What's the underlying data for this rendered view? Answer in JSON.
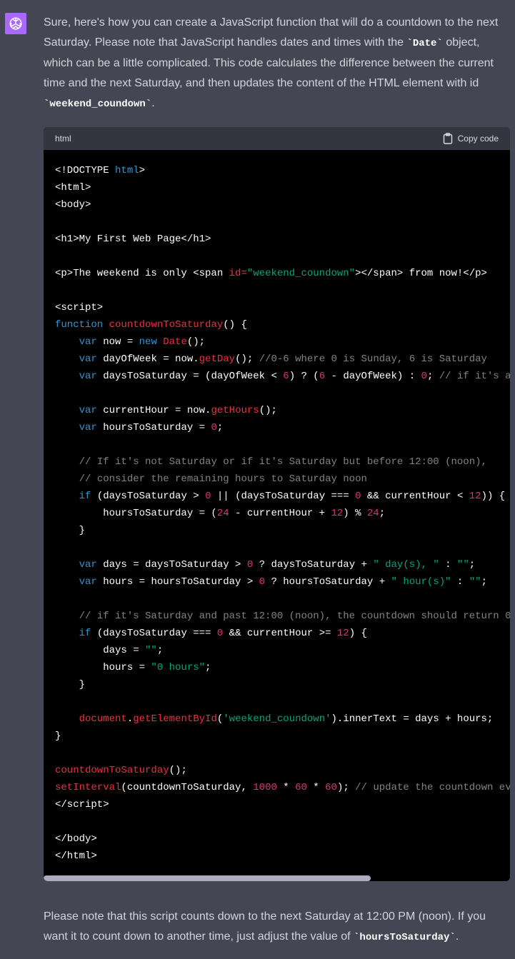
{
  "assistant": {
    "avatar_icon": "openai-logo-icon",
    "avatar_color": "#ab68ff"
  },
  "intro": {
    "before_date": "Sure, here's how you can create a JavaScript function that will do a countdown to the next Saturday. Please note that JavaScript handles dates and times with the ",
    "date_code": "`Date`",
    "middle": " object, which can be a little complicated. This code calculates the difference between the current time and the next Saturday, and then updates the content of the HTML element with id ",
    "id_code": "`weekend_coundown`",
    "end": "."
  },
  "code_block": {
    "language": "html",
    "copy_label": "Copy code",
    "copy_icon": "clipboard-icon",
    "scroll_position_fraction": 0,
    "lines": [
      [
        [
          "t",
          "<!DOCTYPE "
        ],
        [
          "k",
          "html"
        ],
        [
          "t",
          ">"
        ]
      ],
      [
        [
          "t",
          "<html>"
        ]
      ],
      [
        [
          "t",
          "<body>"
        ]
      ],
      [],
      [
        [
          "t",
          "<h1>My First Web Page</h1>"
        ]
      ],
      [],
      [
        [
          "t",
          "<p>The weekend is only <span "
        ],
        [
          "a",
          "id="
        ],
        [
          "s",
          "\"weekend_coundown\""
        ],
        [
          "t",
          "></span> from now!</p>"
        ]
      ],
      [],
      [
        [
          "t",
          "<script>"
        ]
      ],
      [
        [
          "k",
          "function "
        ],
        [
          "f",
          "countdownToSaturday"
        ],
        [
          "t",
          "() {"
        ]
      ],
      [
        [
          "t",
          "    "
        ],
        [
          "k",
          "var"
        ],
        [
          "t",
          " now = "
        ],
        [
          "k",
          "new "
        ],
        [
          "f",
          "Date"
        ],
        [
          "t",
          "();"
        ]
      ],
      [
        [
          "t",
          "    "
        ],
        [
          "k",
          "var"
        ],
        [
          "t",
          " dayOfWeek = now."
        ],
        [
          "f",
          "getDay"
        ],
        [
          "t",
          "(); "
        ],
        [
          "c",
          "//0-6 where 0 is Sunday, 6 is Saturday"
        ]
      ],
      [
        [
          "t",
          "    "
        ],
        [
          "k",
          "var"
        ],
        [
          "t",
          " daysToSaturday = (dayOfWeek < "
        ],
        [
          "n",
          "6"
        ],
        [
          "t",
          ") ? ("
        ],
        [
          "n",
          "6"
        ],
        [
          "t",
          " - dayOfWeek) : "
        ],
        [
          "n",
          "0"
        ],
        [
          "t",
          "; "
        ],
        [
          "c",
          "// if it's a"
        ]
      ],
      [],
      [
        [
          "t",
          "    "
        ],
        [
          "k",
          "var"
        ],
        [
          "t",
          " currentHour = now."
        ],
        [
          "f",
          "getHours"
        ],
        [
          "t",
          "();"
        ]
      ],
      [
        [
          "t",
          "    "
        ],
        [
          "k",
          "var"
        ],
        [
          "t",
          " hoursToSaturday = "
        ],
        [
          "n",
          "0"
        ],
        [
          "t",
          ";"
        ]
      ],
      [],
      [
        [
          "t",
          "    "
        ],
        [
          "c",
          "// If it's not Saturday or if it's Saturday but before 12:00 (noon),"
        ]
      ],
      [
        [
          "t",
          "    "
        ],
        [
          "c",
          "// consider the remaining hours to Saturday noon"
        ]
      ],
      [
        [
          "t",
          "    "
        ],
        [
          "k",
          "if"
        ],
        [
          "t",
          " (daysToSaturday > "
        ],
        [
          "n",
          "0"
        ],
        [
          "t",
          " || (daysToSaturday === "
        ],
        [
          "n",
          "0"
        ],
        [
          "t",
          " && currentHour < "
        ],
        [
          "n",
          "12"
        ],
        [
          "t",
          ")) {"
        ]
      ],
      [
        [
          "t",
          "        hoursToSaturday = ("
        ],
        [
          "n",
          "24"
        ],
        [
          "t",
          " - currentHour + "
        ],
        [
          "n",
          "12"
        ],
        [
          "t",
          ") % "
        ],
        [
          "n",
          "24"
        ],
        [
          "t",
          ";"
        ]
      ],
      [
        [
          "t",
          "    }"
        ]
      ],
      [],
      [
        [
          "t",
          "    "
        ],
        [
          "k",
          "var"
        ],
        [
          "t",
          " days = daysToSaturday > "
        ],
        [
          "n",
          "0"
        ],
        [
          "t",
          " ? daysToSaturday + "
        ],
        [
          "s",
          "\" day(s), \""
        ],
        [
          "t",
          " : "
        ],
        [
          "s",
          "\"\""
        ],
        [
          "t",
          ";"
        ]
      ],
      [
        [
          "t",
          "    "
        ],
        [
          "k",
          "var"
        ],
        [
          "t",
          " hours = hoursToSaturday > "
        ],
        [
          "n",
          "0"
        ],
        [
          "t",
          " ? hoursToSaturday + "
        ],
        [
          "s",
          "\" hour(s)\""
        ],
        [
          "t",
          " : "
        ],
        [
          "s",
          "\"\""
        ],
        [
          "t",
          ";"
        ]
      ],
      [],
      [
        [
          "t",
          "    "
        ],
        [
          "c",
          "// if it's Saturday and past 12:00 (noon), the countdown should return 0"
        ]
      ],
      [
        [
          "t",
          "    "
        ],
        [
          "k",
          "if"
        ],
        [
          "t",
          " (daysToSaturday === "
        ],
        [
          "n",
          "0"
        ],
        [
          "t",
          " && currentHour >= "
        ],
        [
          "n",
          "12"
        ],
        [
          "t",
          ") {"
        ]
      ],
      [
        [
          "t",
          "        days = "
        ],
        [
          "s",
          "\"\""
        ],
        [
          "t",
          ";"
        ]
      ],
      [
        [
          "t",
          "        hours = "
        ],
        [
          "s",
          "\"0 hours\""
        ],
        [
          "t",
          ";"
        ]
      ],
      [
        [
          "t",
          "    }"
        ]
      ],
      [],
      [
        [
          "t",
          "    "
        ],
        [
          "f",
          "document"
        ],
        [
          "t",
          "."
        ],
        [
          "f",
          "getElementById"
        ],
        [
          "t",
          "("
        ],
        [
          "s",
          "'weekend_coundown'"
        ],
        [
          "t",
          ").innerText = days + hours;"
        ]
      ],
      [
        [
          "t",
          "}"
        ]
      ],
      [],
      [
        [
          "f",
          "countdownToSaturday"
        ],
        [
          "t",
          "();"
        ]
      ],
      [
        [
          "f",
          "setInterval"
        ],
        [
          "t",
          "(countdownToSaturday, "
        ],
        [
          "n",
          "1000"
        ],
        [
          "t",
          " * "
        ],
        [
          "n",
          "60"
        ],
        [
          "t",
          " * "
        ],
        [
          "n",
          "60"
        ],
        [
          "t",
          "); "
        ],
        [
          "c",
          "// update the countdown ev"
        ]
      ],
      [
        [
          "t",
          "</script>"
        ]
      ],
      [],
      [
        [
          "t",
          "</body>"
        ]
      ],
      [
        [
          "t",
          "</html>"
        ]
      ]
    ]
  },
  "outro": {
    "text": "Please note that this script counts down to the next Saturday at 12:00 PM (noon). If you want it to count down to another time, just adjust the value of ",
    "code": "`hoursToSaturday`",
    "end": "."
  }
}
